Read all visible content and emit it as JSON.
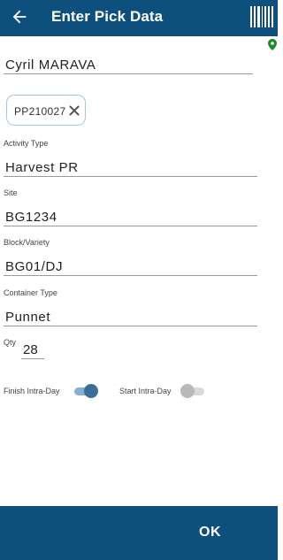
{
  "app_bar": {
    "title": "Enter Pick Data",
    "back_icon": "arrow-left-icon",
    "barcode_icon": "barcode-icon",
    "background": "#0d4f7d"
  },
  "status": {
    "location_icon": "location-pin-icon",
    "location_color": "#1a8a2a"
  },
  "picker": {
    "name": "Cyril MARAVA"
  },
  "chip": {
    "label": "PP210027",
    "remove_icon": "close-icon"
  },
  "activity_type": {
    "label": "Activity Type",
    "value": "Harvest PR"
  },
  "site": {
    "label": "Site",
    "value": "BG1234"
  },
  "block_variety": {
    "label": "Block/Variety",
    "value": "BG01/DJ"
  },
  "container_type": {
    "label": "Container Type",
    "value": "Punnet"
  },
  "qty": {
    "label": "Qty",
    "value": "28"
  },
  "toggles": {
    "finish_intra_day": {
      "label": "Finish Intra-Day",
      "checked": true
    },
    "start_intra_day": {
      "label": "Start Intra-Day",
      "checked": false
    }
  },
  "bottom_bar": {
    "ok_label": "OK"
  }
}
